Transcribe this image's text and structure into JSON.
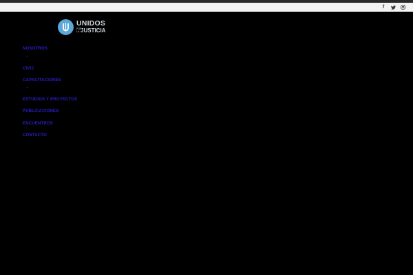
{
  "brand": {
    "line1": "UNIDOS",
    "line2_small": "POR LA",
    "line2_big": "JUSTICIA",
    "accent_color": "#5aa7d8"
  },
  "social": [
    {
      "icon": "facebook-icon",
      "glyph": "f"
    },
    {
      "icon": "twitter-icon"
    },
    {
      "icon": "instagram-icon"
    }
  ],
  "nav": {
    "link_color": "#2b1fd0",
    "items": [
      {
        "label": "NOSOTROS",
        "has_submenu": true
      },
      {
        "label": "CIVIJ",
        "has_submenu": false
      },
      {
        "label": "CAPACITACIONES",
        "has_submenu": true
      },
      {
        "label": "ESTUDIOS Y PROYECTOS",
        "has_submenu": false
      },
      {
        "label": "PUBLICACIONES",
        "has_submenu": false
      },
      {
        "label": "ENCUENTROS",
        "has_submenu": false
      },
      {
        "label": "CONTACTO",
        "has_submenu": false
      }
    ],
    "submenu_glyph": "⌄"
  }
}
